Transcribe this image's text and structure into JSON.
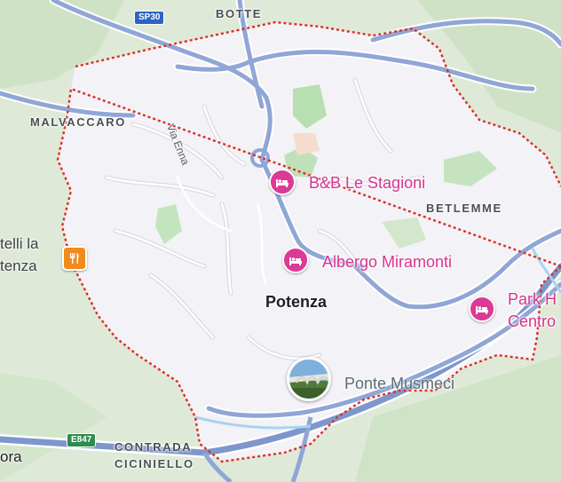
{
  "map": {
    "area_labels": {
      "botte": "BOTTE",
      "malvaccaro": "MALVACCARO",
      "betlemme": "BETLEMME",
      "contrada_line1": "CONTRADA",
      "contrada_line2": "CICINIELLO"
    },
    "city_label": "Potenza",
    "road_labels": {
      "via_enna": "Via Enna"
    },
    "road_shields": {
      "sp30": "SP30",
      "e847": "E847"
    },
    "hotels": [
      {
        "name": "B&B Le Stagioni",
        "icon": "hotel-bed-icon"
      },
      {
        "name": "Albergo Miramonti",
        "icon": "hotel-bed-icon"
      },
      {
        "name_line1": "Park H",
        "name_line2": "Centro",
        "icon": "hotel-bed-icon"
      }
    ],
    "restaurant": {
      "name_line1": "telli la",
      "name_line2": "tenza",
      "icon": "restaurant-icon"
    },
    "landmark": {
      "name": "Ponte Musmeci",
      "icon": "photo-thumbnail"
    },
    "edge_label": "ora",
    "colors": {
      "land": "#dfe9d7",
      "city_area": "#f3f2f6",
      "boundary": "#d93025",
      "highway": "#8fa6d6",
      "hotel": "#d6338f",
      "restaurant": "#f08a1c",
      "park": "#b7dfb2"
    }
  }
}
